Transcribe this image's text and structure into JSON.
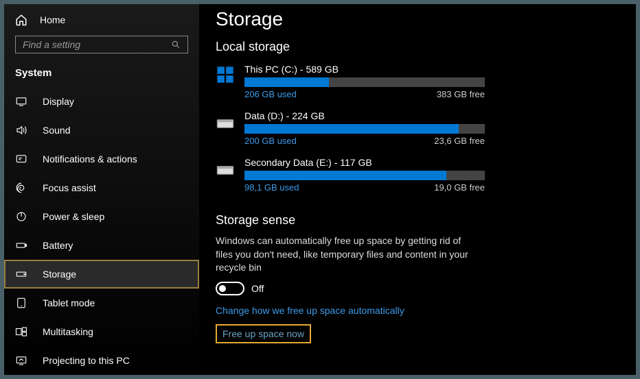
{
  "sidebar": {
    "home": "Home",
    "search_placeholder": "Find a setting",
    "category": "System",
    "items": [
      {
        "label": "Display"
      },
      {
        "label": "Sound"
      },
      {
        "label": "Notifications & actions"
      },
      {
        "label": "Focus assist"
      },
      {
        "label": "Power & sleep"
      },
      {
        "label": "Battery"
      },
      {
        "label": "Storage"
      },
      {
        "label": "Tablet mode"
      },
      {
        "label": "Multitasking"
      },
      {
        "label": "Projecting to this PC"
      }
    ]
  },
  "main": {
    "title": "Storage",
    "local_storage_heading": "Local storage",
    "drives": [
      {
        "name": "This PC (C:) - 589 GB",
        "used": "206 GB used",
        "free": "383 GB free",
        "pct": 35
      },
      {
        "name": "Data (D:) - 224 GB",
        "used": "200 GB used",
        "free": "23,6 GB free",
        "pct": 89
      },
      {
        "name": "Secondary Data (E:) - 117 GB",
        "used": "98,1 GB used",
        "free": "19,0 GB free",
        "pct": 84
      }
    ],
    "storage_sense": {
      "heading": "Storage sense",
      "description": "Windows can automatically free up space by getting rid of files you don't need, like temporary files and content in your recycle bin",
      "toggle_state": "Off",
      "link_change": "Change how we free up space automatically",
      "link_free": "Free up space now"
    }
  }
}
